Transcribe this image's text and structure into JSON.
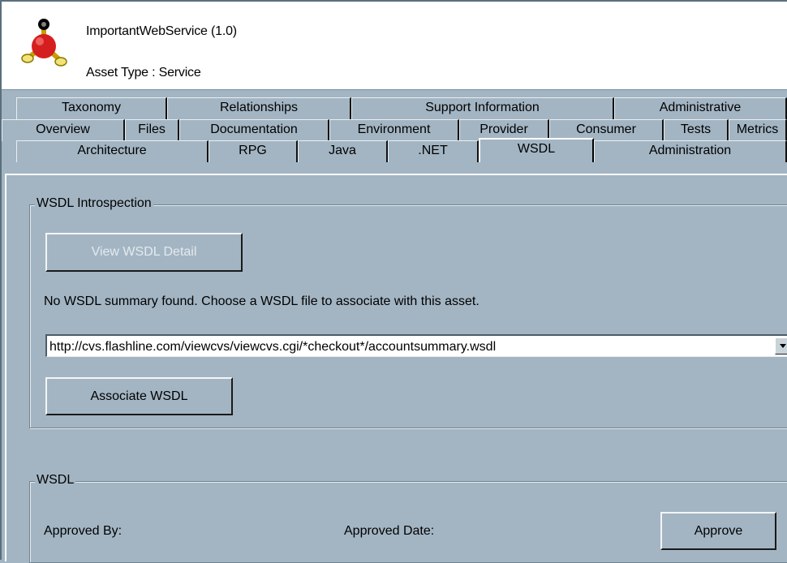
{
  "header": {
    "title": "ImportantWebService (1.0)",
    "asset_type": "Asset Type : Service",
    "icon": "molecule-icon"
  },
  "tabs": {
    "row1": [
      "Taxonomy",
      "Relationships",
      "Support Information",
      "Administrative"
    ],
    "row2": [
      "Overview",
      "Files",
      "Documentation",
      "Environment",
      "Provider",
      "Consumer",
      "Tests",
      "Metrics"
    ],
    "row3": [
      "Architecture",
      "RPG",
      "Java",
      ".NET",
      "WSDL",
      "Administration"
    ],
    "selected": "WSDL"
  },
  "introspection": {
    "legend": "WSDL Introspection",
    "view_detail_label": "View WSDL Detail",
    "message": "No WSDL summary found.  Choose a WSDL file to associate with this asset.",
    "wsdl_url": "http://cvs.flashline.com/viewcvs/viewcvs.cgi/*checkout*/accountsummary.wsdl",
    "associate_label": "Associate WSDL"
  },
  "wsdl": {
    "legend": "WSDL",
    "approved_by_label": "Approved By:",
    "approved_date_label": "Approved Date:",
    "approve_label": "Approve"
  },
  "colors": {
    "panel": "#a3b5c3",
    "header_bg": "#ffffff"
  }
}
